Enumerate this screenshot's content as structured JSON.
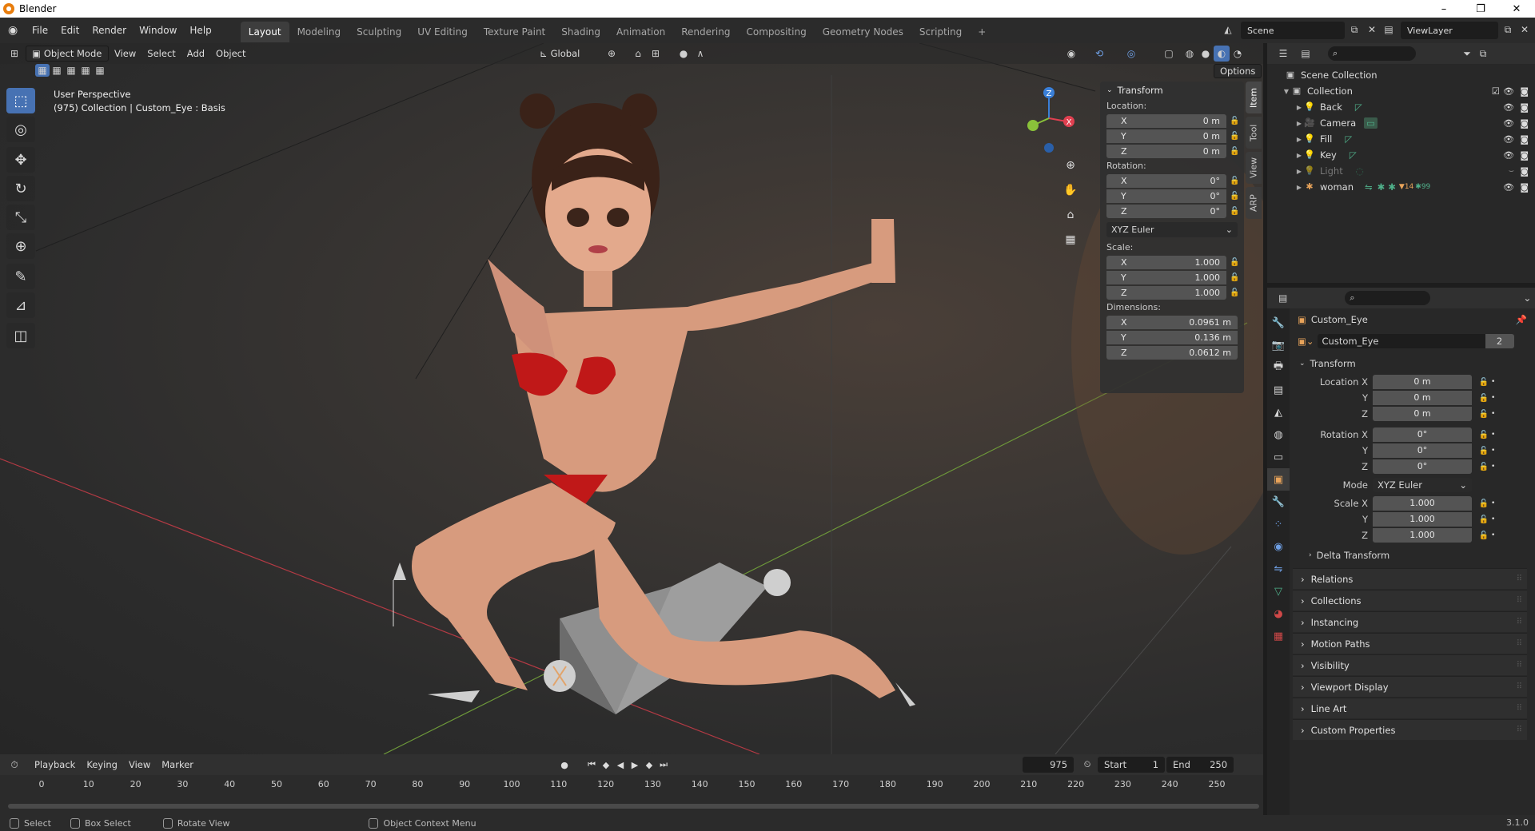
{
  "window": {
    "title": "Blender",
    "minimize": "–",
    "restore": "❐",
    "close": "✕"
  },
  "menu": [
    "File",
    "Edit",
    "Render",
    "Window",
    "Help"
  ],
  "workspaces": [
    "Layout",
    "Modeling",
    "Sculpting",
    "UV Editing",
    "Texture Paint",
    "Shading",
    "Animation",
    "Rendering",
    "Compositing",
    "Geometry Nodes",
    "Scripting"
  ],
  "workspaces_add": "+",
  "active_workspace": "Layout",
  "scene": {
    "name": "Scene",
    "view_layer": "ViewLayer"
  },
  "viewport": {
    "mode": "Object Mode",
    "menus": [
      "View",
      "Select",
      "Add",
      "Object"
    ],
    "transform_orientation": "Global",
    "options_label": "Options",
    "info_line1": "User Perspective",
    "info_line2": "(975) Collection | Custom_Eye : Basis"
  },
  "npanel": {
    "title": "Transform",
    "location_label": "Location:",
    "location": [
      {
        "axis": "X",
        "value": "0 m"
      },
      {
        "axis": "Y",
        "value": "0 m"
      },
      {
        "axis": "Z",
        "value": "0 m"
      }
    ],
    "rotation_label": "Rotation:",
    "rotation": [
      {
        "axis": "X",
        "value": "0°"
      },
      {
        "axis": "Y",
        "value": "0°"
      },
      {
        "axis": "Z",
        "value": "0°"
      }
    ],
    "rotation_mode": "XYZ Euler",
    "scale_label": "Scale:",
    "scale": [
      {
        "axis": "X",
        "value": "1.000"
      },
      {
        "axis": "Y",
        "value": "1.000"
      },
      {
        "axis": "Z",
        "value": "1.000"
      }
    ],
    "dimensions_label": "Dimensions:",
    "dimensions": [
      {
        "axis": "X",
        "value": "0.0961 m"
      },
      {
        "axis": "Y",
        "value": "0.136 m"
      },
      {
        "axis": "Z",
        "value": "0.0612 m"
      }
    ],
    "tabs": [
      "Item",
      "Tool",
      "View",
      "ARP"
    ]
  },
  "gizmo": {
    "x": "X",
    "y": "Y",
    "z": "Z"
  },
  "timeline": {
    "menus": [
      "Playback",
      "Keying",
      "View",
      "Marker"
    ],
    "current_frame": "975",
    "start_label": "Start",
    "start": "1",
    "end_label": "End",
    "end": "250",
    "ticks": [
      "0",
      "10",
      "20",
      "30",
      "40",
      "50",
      "60",
      "70",
      "80",
      "90",
      "100",
      "110",
      "120",
      "130",
      "140",
      "150",
      "160",
      "170",
      "180",
      "190",
      "200",
      "210",
      "220",
      "230",
      "240",
      "250"
    ]
  },
  "statusbar": {
    "select": "Select",
    "box_select": "Box Select",
    "rotate_view": "Rotate View",
    "context_menu": "Object Context Menu",
    "version": "3.1.0"
  },
  "outliner": {
    "scene_collection": "Scene Collection",
    "collection": "Collection",
    "items": [
      {
        "name": "Back",
        "dim": false
      },
      {
        "name": "Camera",
        "dim": false
      },
      {
        "name": "Fill",
        "dim": false
      },
      {
        "name": "Key",
        "dim": false
      },
      {
        "name": "Light",
        "dim": true
      },
      {
        "name": "woman",
        "dim": false
      }
    ],
    "woman_badge": "14",
    "woman_badge2": "99"
  },
  "properties": {
    "object_name": "Custom_Eye",
    "data_name": "Custom_Eye",
    "data_users": "2",
    "transform_title": "Transform",
    "location": [
      {
        "label": "Location X",
        "value": "0 m"
      },
      {
        "label": "Y",
        "value": "0 m"
      },
      {
        "label": "Z",
        "value": "0 m"
      }
    ],
    "rotation": [
      {
        "label": "Rotation X",
        "value": "0°"
      },
      {
        "label": "Y",
        "value": "0°"
      },
      {
        "label": "Z",
        "value": "0°"
      }
    ],
    "mode_label": "Mode",
    "mode_value": "XYZ Euler",
    "scale": [
      {
        "label": "Scale X",
        "value": "1.000"
      },
      {
        "label": "Y",
        "value": "1.000"
      },
      {
        "label": "Z",
        "value": "1.000"
      }
    ],
    "delta_transform": "Delta Transform",
    "sections": [
      "Relations",
      "Collections",
      "Instancing",
      "Motion Paths",
      "Visibility",
      "Viewport Display",
      "Line Art",
      "Custom Properties"
    ]
  },
  "colors": {
    "accent": "#4772b3",
    "x_axis": "#e04050",
    "y_axis": "#8ac23a",
    "z_axis": "#3a7fd8",
    "skin": "#d79b7e",
    "bikini": "#c01818"
  }
}
